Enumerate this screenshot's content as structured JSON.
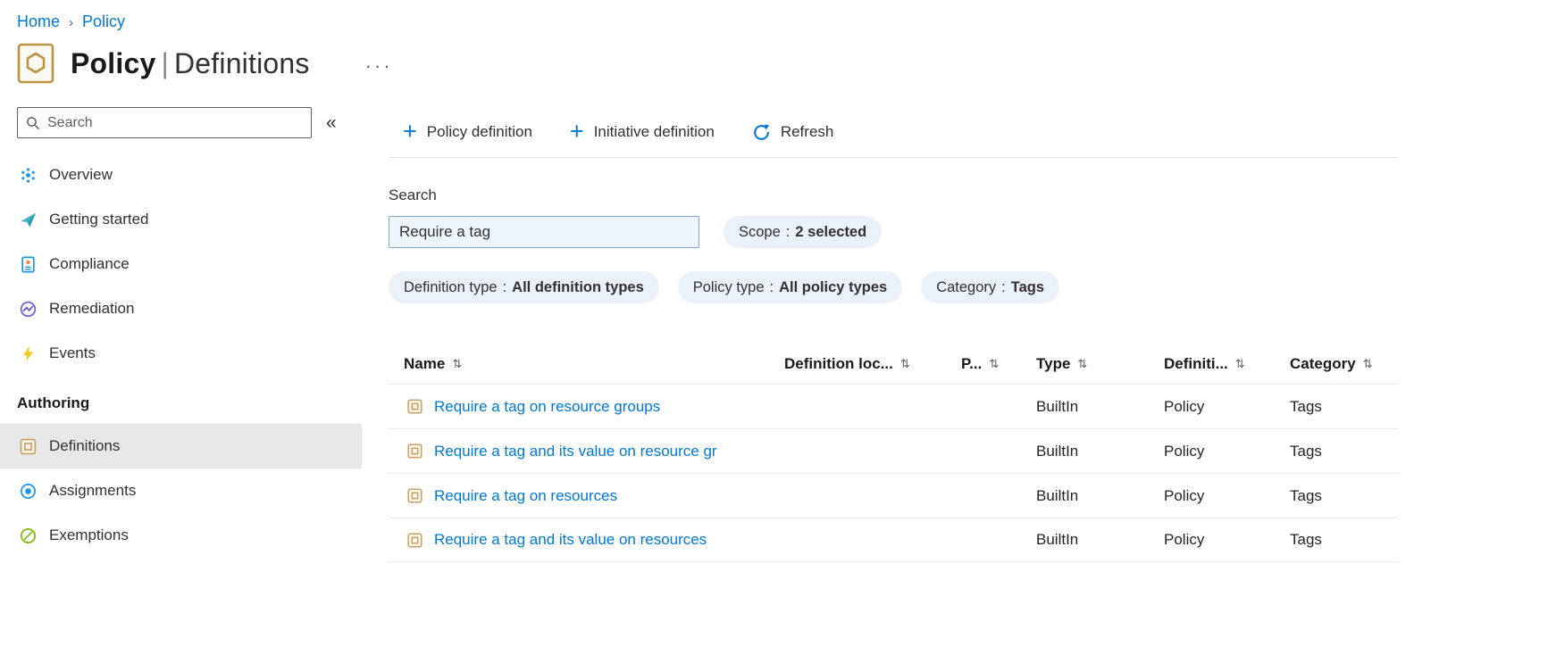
{
  "icons": {
    "plus": "+",
    "collapse": "«",
    "sort": "⇅",
    "ellipsis": "···",
    "breadcrumb_separator": "›"
  },
  "colors": {
    "accent": "#0078d4",
    "link": "#0078d4",
    "pill_background": "#eaf1f8",
    "selected_item_background": "#e8e8e8",
    "policy_icon": "#b99543"
  },
  "breadcrumb": {
    "items": [
      {
        "label": "Home"
      },
      {
        "label": "Policy"
      }
    ]
  },
  "header": {
    "title": "Policy",
    "separator": "|",
    "subtitle": "Definitions"
  },
  "sidebar": {
    "search": {
      "placeholder": "Search"
    },
    "items": [
      {
        "label": "Overview"
      },
      {
        "label": "Getting started"
      },
      {
        "label": "Compliance"
      },
      {
        "label": "Remediation"
      },
      {
        "label": "Events"
      }
    ],
    "section_label": "Authoring",
    "authoring_items": [
      {
        "label": "Definitions",
        "selected": true
      },
      {
        "label": "Assignments",
        "selected": false
      },
      {
        "label": "Exemptions",
        "selected": false
      }
    ]
  },
  "toolbar": {
    "buttons": [
      {
        "label": "Policy definition"
      },
      {
        "label": "Initiative definition"
      },
      {
        "label": "Refresh"
      }
    ]
  },
  "filters": {
    "search_label": "Search",
    "search_value": "Require a tag",
    "pills": [
      {
        "label": "Scope",
        "separator": ":",
        "value": "2 selected"
      },
      {
        "label": "Definition type",
        "separator": ":",
        "value": "All definition types"
      },
      {
        "label": "Policy type",
        "separator": ":",
        "value": "All policy types"
      },
      {
        "label": "Category",
        "separator": ":",
        "value": "Tags"
      }
    ]
  },
  "table": {
    "columns": [
      {
        "label": "Name"
      },
      {
        "label": "Definition loc..."
      },
      {
        "label": "P..."
      },
      {
        "label": "Type"
      },
      {
        "label": "Definiti..."
      },
      {
        "label": "Category"
      }
    ],
    "rows": [
      {
        "name": "Require a tag on resource groups",
        "definition_location": "",
        "policies": "",
        "type": "BuiltIn",
        "definition_type": "Policy",
        "category": "Tags"
      },
      {
        "name": "Require a tag and its value on resource gr",
        "definition_location": "",
        "policies": "",
        "type": "BuiltIn",
        "definition_type": "Policy",
        "category": "Tags"
      },
      {
        "name": "Require a tag on resources",
        "definition_location": "",
        "policies": "",
        "type": "BuiltIn",
        "definition_type": "Policy",
        "category": "Tags"
      },
      {
        "name": "Require a tag and its value on resources",
        "definition_location": "",
        "policies": "",
        "type": "BuiltIn",
        "definition_type": "Policy",
        "category": "Tags"
      }
    ]
  }
}
